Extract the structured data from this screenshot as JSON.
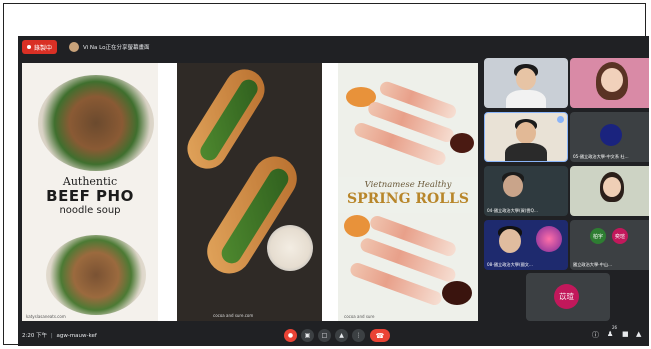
{
  "recording": {
    "label": "錄製中"
  },
  "presenter": {
    "name": "Vi Na Lo正在分享螢幕畫面"
  },
  "slides": {
    "pho": {
      "line1": "Authentic",
      "line2": "BEEF PHO",
      "line3": "noodle soup",
      "credit": "katyslasaneats.com"
    },
    "banhmi": {
      "credit": "cocoa and sure.com"
    },
    "springrolls": {
      "line1": "Vietnamese Healthy",
      "line2": "SPRING ROLLS",
      "credit": "cocoa and sure"
    }
  },
  "participants": [
    {
      "label": ""
    },
    {
      "label": ""
    },
    {
      "label": ""
    },
    {
      "label": "05-國立政治大學-中文系 杜..."
    },
    {
      "label": "04-國立政治大學(資)雲Q..."
    },
    {
      "label": ""
    },
    {
      "label": "08-國立政治大學(國文..."
    },
    {
      "label": "國立政治大學-中山...",
      "initials": "柏宇",
      "initials2": "奕瑄"
    }
  ],
  "self": {
    "initials": "苡瑄"
  },
  "bottom": {
    "time": "2:20 下午",
    "separator": "|",
    "meeting_code": "agw-mauw-kef"
  },
  "badges": {
    "people": "26"
  },
  "colors": {
    "meet_bg": "#202124",
    "record": "#d93025",
    "hangup": "#ea4335",
    "accent": "#8ab4f8"
  }
}
